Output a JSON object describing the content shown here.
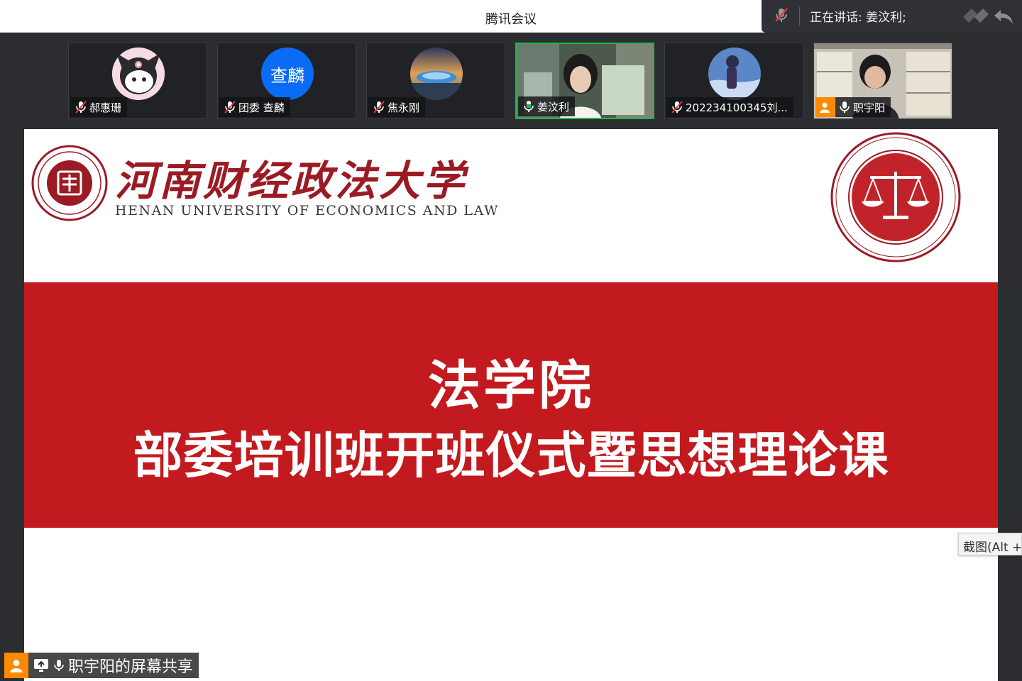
{
  "window": {
    "title": "腾讯会议"
  },
  "speaking": {
    "text": "正在讲话: 姜汶利;"
  },
  "participants": [
    {
      "name": "郝惠珊",
      "mic": "muted"
    },
    {
      "name": "团委 查麟",
      "mic": "muted",
      "avatar_text": "查麟"
    },
    {
      "name": "焦永刚",
      "mic": "muted"
    },
    {
      "name": "姜汶利",
      "mic": "on",
      "active": true
    },
    {
      "name": "202234100345刘...",
      "mic": "muted"
    },
    {
      "name": "职宇阳",
      "mic": "on",
      "host": true
    }
  ],
  "slide": {
    "university_cn": "河南财经政法大学",
    "university_en": "HENAN UNIVERSITY OF ECONOMICS AND LAW",
    "title_line1": "法学院",
    "title_line2": "部委培训班开班仪式暨思想理论课"
  },
  "screenshot_tip": "截图(Alt +",
  "share_label": "职宇阳的屏幕共享",
  "colors": {
    "banner_red": "#c21a1e",
    "active_border": "#1fb84a",
    "host_orange": "#ff8a00",
    "seal_red": "#9b1b24"
  }
}
